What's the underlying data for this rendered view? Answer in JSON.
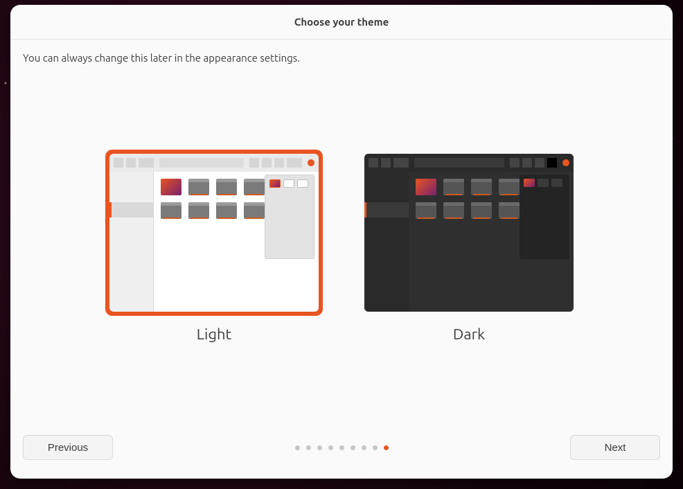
{
  "header": {
    "title": "Choose your theme"
  },
  "subtitle": "You can always change this later in the appearance settings.",
  "themes": {
    "light": {
      "label": "Light",
      "selected": true
    },
    "dark": {
      "label": "Dark",
      "selected": false
    }
  },
  "pager": {
    "total": 9,
    "current": 9
  },
  "buttons": {
    "previous": "Previous",
    "next": "Next"
  }
}
